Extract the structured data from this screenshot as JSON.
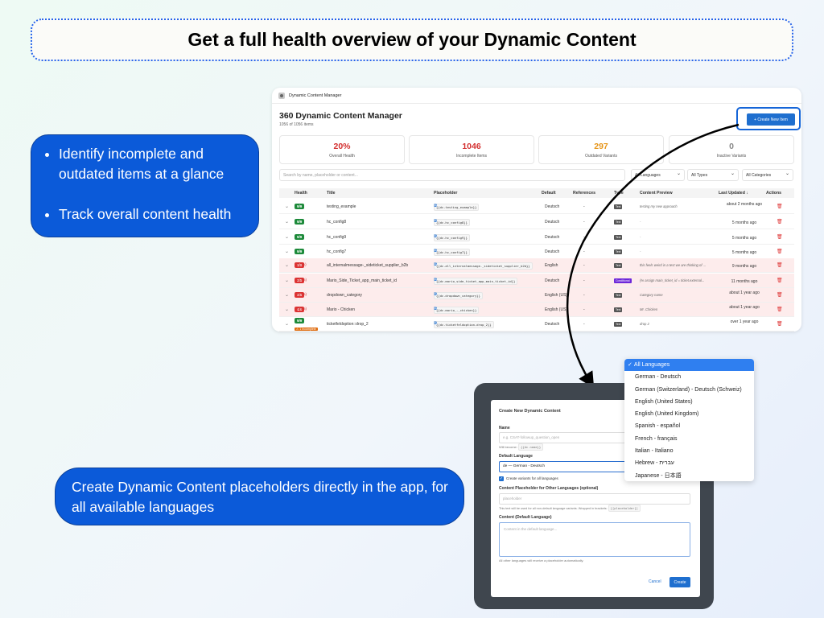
{
  "headline": "Get a full health overview of your Dynamic Content",
  "callouts": {
    "first": [
      "Identify incomplete and outdated items at a glance",
      "Track overall content health"
    ],
    "second": "Create Dynamic Content placeholders directly in the app, for all available languages"
  },
  "manager": {
    "app_name": "Dynamic Content Manager",
    "title": "360 Dynamic Content Manager",
    "subtitle": "1056 of 1056 items",
    "create_button": "+ Create New Item",
    "stats": [
      {
        "value": "20%",
        "label": "Overall Health",
        "color": "#d32f2f"
      },
      {
        "value": "1046",
        "label": "Incomplete Items",
        "color": "#d32f2f"
      },
      {
        "value": "297",
        "label": "Outdated Variants",
        "color": "#e69519"
      },
      {
        "value": "0",
        "label": "Inactive Variants",
        "color": "#888888"
      }
    ],
    "search_placeholder": "Search by name, placeholder or content...",
    "filters": [
      "All Languages",
      "All Types",
      "All Categories"
    ],
    "columns": [
      "Health",
      "Title",
      "Placeholder",
      "Default",
      "References",
      "Type",
      "Content Preview",
      "Last Updated ↓",
      "Actions"
    ],
    "rows": [
      {
        "health": "9/9",
        "status": "ok",
        "pct": "",
        "title": "testing_example",
        "placeholder": "{{dc.testing_example}}",
        "default": "Deutsch",
        "refs": "-",
        "type": "Text",
        "preview": "testing my new approach",
        "updated": "about 2 months ago"
      },
      {
        "health": "9/9",
        "status": "ok",
        "pct": "",
        "title": "hc_config8",
        "placeholder": "{{dc.hc_config8}}",
        "default": "Deutsch",
        "refs": "-",
        "type": "Text",
        "preview": "-",
        "updated": "5 months ago"
      },
      {
        "health": "9/9",
        "status": "ok",
        "pct": "",
        "title": "hc_config9",
        "placeholder": "{{dc.hc_config9}}",
        "default": "Deutsch",
        "refs": "-",
        "type": "Text",
        "preview": "-",
        "updated": "5 months ago"
      },
      {
        "health": "9/9",
        "status": "ok",
        "pct": "",
        "title": "hc_config7",
        "placeholder": "{{dc.hc_config7}}",
        "default": "Deutsch",
        "refs": "-",
        "type": "Text",
        "preview": "-",
        "updated": "5 months ago"
      },
      {
        "health": "1/9",
        "status": "err",
        "pct": "(11%)",
        "title": "all_internalmessage-_sideticket_supplier_b2b",
        "placeholder": "{{dc.all_internalmessage-_sideticket_supplier_b2b}}",
        "default": "English",
        "refs": "-",
        "type": "Text",
        "preview": "this feels weird in a test we are thinking of ...",
        "updated": "9 months ago"
      },
      {
        "health": "2/9",
        "status": "err",
        "pct": "(22%)",
        "title": "Mario_Side_Ticket_app_main_ticket_id",
        "placeholder": "{{dc.mario_side_ticket_app_main_ticket_id}}",
        "default": "Deutsch",
        "refs": "-",
        "type": "Conditional",
        "preview": "{% assign main_ticket_id = ticket.external...",
        "updated": "11 months ago"
      },
      {
        "health": "2/9",
        "status": "err",
        "pct": "(22%)",
        "title": "dropdown_category",
        "placeholder": "{{dc.dropdown_category}}",
        "default": "English (US)",
        "refs": "-",
        "type": "Text",
        "preview": "Category name",
        "updated": "about 1 year ago"
      },
      {
        "health": "4/9",
        "status": "err",
        "pct": "(44%)",
        "title": "Mario - Chicken",
        "placeholder": "{{dc.mario_-_chicken}}",
        "default": "English (US)",
        "refs": "-",
        "type": "Text",
        "preview": "Mr. Chicken",
        "updated": "about 1 year ago"
      },
      {
        "health": "9/9",
        "status": "ok",
        "pct": "",
        "title": "ticketfeldoption::drop_2",
        "placeholder": "{{dc.ticketfeldoption-drop_2}}",
        "default": "Deutsch",
        "refs": "-",
        "type": "Text",
        "preview": "drop 2",
        "updated": "over 1 year ago",
        "warning": "⚠ 1 Incomplete"
      }
    ]
  },
  "modal": {
    "title": "Create New Dynamic Content",
    "name_label": "Name",
    "name_placeholder": "e.g. CSAT-followup_question_open",
    "will_become": "Will become:",
    "will_become_code": "{{dc.name}}",
    "default_language_label": "Default Language",
    "default_language_value": "de — German - Deutsch",
    "checkbox_label": "Create variants for all languages",
    "other_label": "Content Placeholder for Other Languages (optional)",
    "other_placeholder": "placeholder",
    "other_hint": "This text will be used for all non-default language variants. Wrapped in brackets:",
    "other_hint_code": "[[placeholder]]",
    "content_label": "Content (Default Language)",
    "content_placeholder": "Content in the default language...",
    "footer_hint": "All other languages will receive a placeholder automatically.",
    "cancel": "Cancel",
    "create": "Create"
  },
  "language_dropdown": [
    {
      "label": "All Languages",
      "selected": true
    },
    {
      "label": "German - Deutsch"
    },
    {
      "label": "German (Switzerland) - Deutsch (Schweiz)"
    },
    {
      "label": "English (United States)"
    },
    {
      "label": "English (United Kingdom)"
    },
    {
      "label": "Spanish - español"
    },
    {
      "label": "French - français"
    },
    {
      "label": "Italian - Italiano"
    },
    {
      "label": "Hebrew - עברית"
    },
    {
      "label": "Japanese - 日本語"
    }
  ]
}
